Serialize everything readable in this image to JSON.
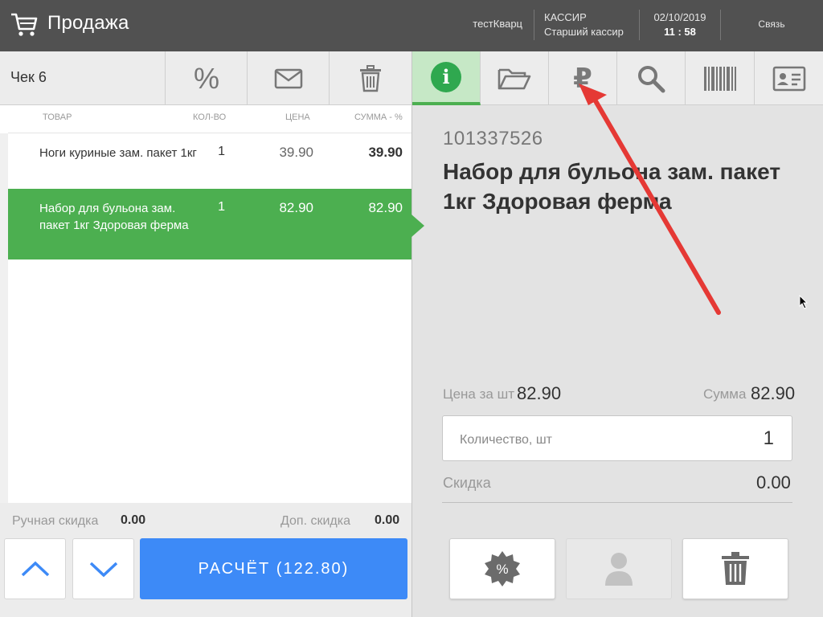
{
  "header": {
    "title": "Продажа",
    "shop": "тестКварц",
    "role_title": "КАССИР",
    "role_name": "Старший кассир",
    "date": "02/10/2019",
    "time": "11 : 58",
    "link": "Связь"
  },
  "receipt": {
    "title": "Чек 6",
    "toolbar": {
      "discount": "%"
    },
    "columns": [
      "ТОВАР",
      "КОЛ-ВО",
      "ЦЕНА",
      "СУММА - %"
    ],
    "items": [
      {
        "name": "Ноги куриные зам. пакет 1кг",
        "qty": "1",
        "price": "39.90",
        "sum": "39.90",
        "selected": false
      },
      {
        "name": "Набор для бульона зам. пакет 1кг Здоровая ферма",
        "qty": "1",
        "price": "82.90",
        "sum": "82.90",
        "selected": true
      }
    ],
    "manual_discount_label": "Ручная скидка",
    "manual_discount": "0.00",
    "extra_discount_label": "Доп. скидка",
    "extra_discount": "0.00",
    "pay_button": "РАСЧЁТ (122.80)"
  },
  "details": {
    "barcode": "101337526",
    "name": "Набор для бульона зам. пакет 1кг Здоровая ферма",
    "price_label": "Цена за шт",
    "price": "82.90",
    "sum_label": "Сумма",
    "sum": "82.90",
    "qty_label": "Количество, шт",
    "qty": "1",
    "discount_label": "Скидка",
    "discount": "0.00"
  },
  "colors": {
    "header": "#515151",
    "accent_green": "#4caf50",
    "pay_blue": "#3d8af7",
    "annotation_red": "#e53935"
  }
}
